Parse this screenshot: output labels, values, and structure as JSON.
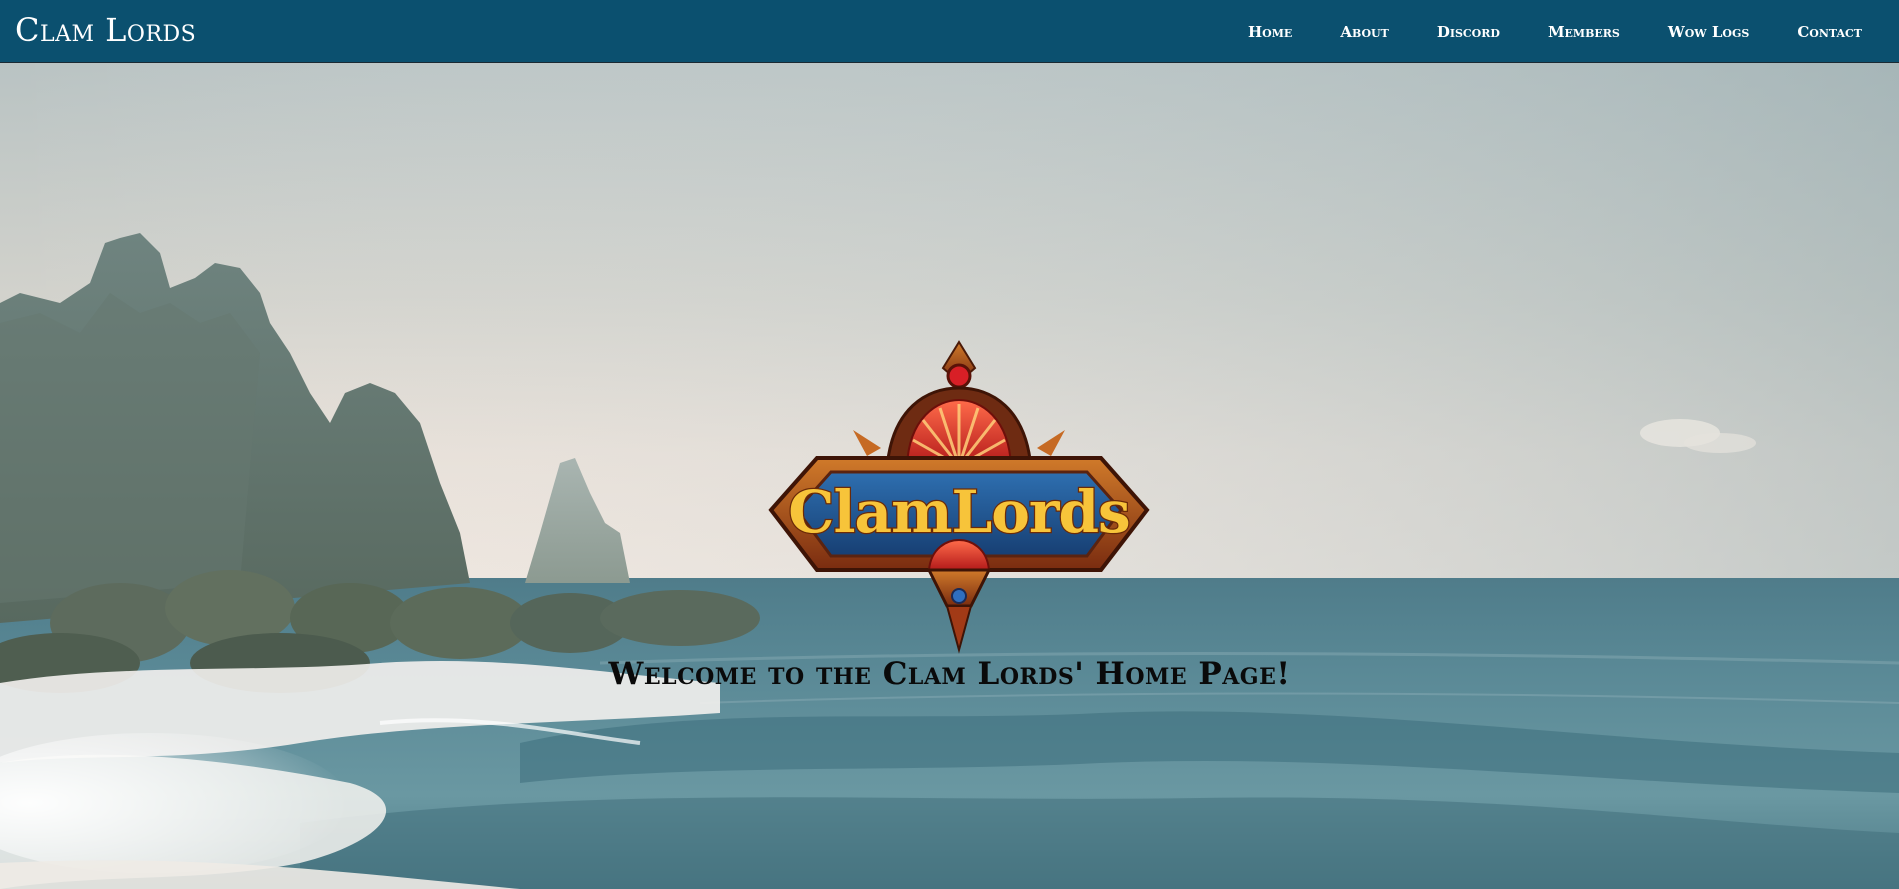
{
  "site": {
    "brand": "Clam Lords"
  },
  "nav": {
    "items": [
      {
        "label": "Home"
      },
      {
        "label": "About"
      },
      {
        "label": "Discord"
      },
      {
        "label": "Members"
      },
      {
        "label": "Wow Logs"
      },
      {
        "label": "Contact"
      }
    ]
  },
  "hero": {
    "logo_text": "ClamLords",
    "welcome": "Welcome to the Clam Lords' Home Page!"
  },
  "colors": {
    "navbar_bg": "#0b506f",
    "nav_text": "#ffffff",
    "welcome_text": "#0a0a0a"
  }
}
